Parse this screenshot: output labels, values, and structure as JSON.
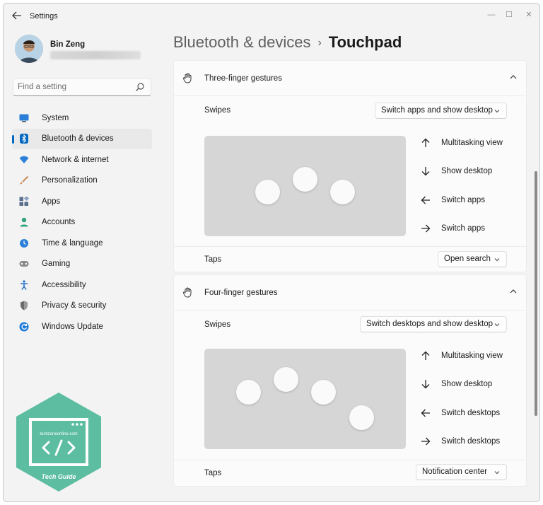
{
  "window": {
    "title": "Settings",
    "controls": {
      "minimize": "—",
      "maximize": "☐",
      "close": "✕"
    }
  },
  "profile": {
    "name": "Bin Zeng"
  },
  "search": {
    "placeholder": "Find a setting"
  },
  "sidebar": {
    "items": [
      {
        "label": "System",
        "icon": "monitor-icon",
        "color": "#2b7fd8"
      },
      {
        "label": "Bluetooth & devices",
        "icon": "bluetooth-icon",
        "color": "#0067c0",
        "active": true
      },
      {
        "label": "Network & internet",
        "icon": "wifi-icon",
        "color": "#2b7fd8"
      },
      {
        "label": "Personalization",
        "icon": "brush-icon",
        "color": "#d27a3a"
      },
      {
        "label": "Apps",
        "icon": "apps-icon",
        "color": "#5a6f8c"
      },
      {
        "label": "Accounts",
        "icon": "person-icon",
        "color": "#2fa37a"
      },
      {
        "label": "Time & language",
        "icon": "globe-clock-icon",
        "color": "#2b7fd8"
      },
      {
        "label": "Gaming",
        "icon": "gamepad-icon",
        "color": "#8a8a8a"
      },
      {
        "label": "Accessibility",
        "icon": "accessibility-icon",
        "color": "#1f6fc5"
      },
      {
        "label": "Privacy & security",
        "icon": "shield-icon",
        "color": "#6b6b6b"
      },
      {
        "label": "Windows Update",
        "icon": "update-icon",
        "color": "#1f7ad8"
      }
    ]
  },
  "header": {
    "breadcrumb": "Bluetooth & devices",
    "separator": "›",
    "current": "Touchpad"
  },
  "three_finger": {
    "title": "Three-finger gestures",
    "swipes_label": "Swipes",
    "swipes_value": "Switch apps and show desktop",
    "gestures": [
      {
        "arrow": "up-arrow-icon",
        "label": "Multitasking view"
      },
      {
        "arrow": "down-arrow-icon",
        "label": "Show desktop"
      },
      {
        "arrow": "left-arrow-icon",
        "label": "Switch apps"
      },
      {
        "arrow": "right-arrow-icon",
        "label": "Switch apps"
      }
    ],
    "taps_label": "Taps",
    "taps_value": "Open search"
  },
  "four_finger": {
    "title": "Four-finger gestures",
    "swipes_label": "Swipes",
    "swipes_value": "Switch desktops and show desktop",
    "gestures": [
      {
        "arrow": "up-arrow-icon",
        "label": "Multitasking view"
      },
      {
        "arrow": "down-arrow-icon",
        "label": "Show desktop"
      },
      {
        "arrow": "left-arrow-icon",
        "label": "Switch desktops"
      },
      {
        "arrow": "right-arrow-icon",
        "label": "Switch desktops"
      }
    ],
    "taps_label": "Taps",
    "taps_value": "Notification center"
  },
  "badge": {
    "site": "techzoneonline.com",
    "caption": "Tech Guide",
    "color": "#5cbda0"
  },
  "colors": {
    "accent": "#0067c0",
    "window_bg": "#f3f3f3",
    "card_bg": "#fbfbfb",
    "touchpad": "#d6d6d6"
  }
}
